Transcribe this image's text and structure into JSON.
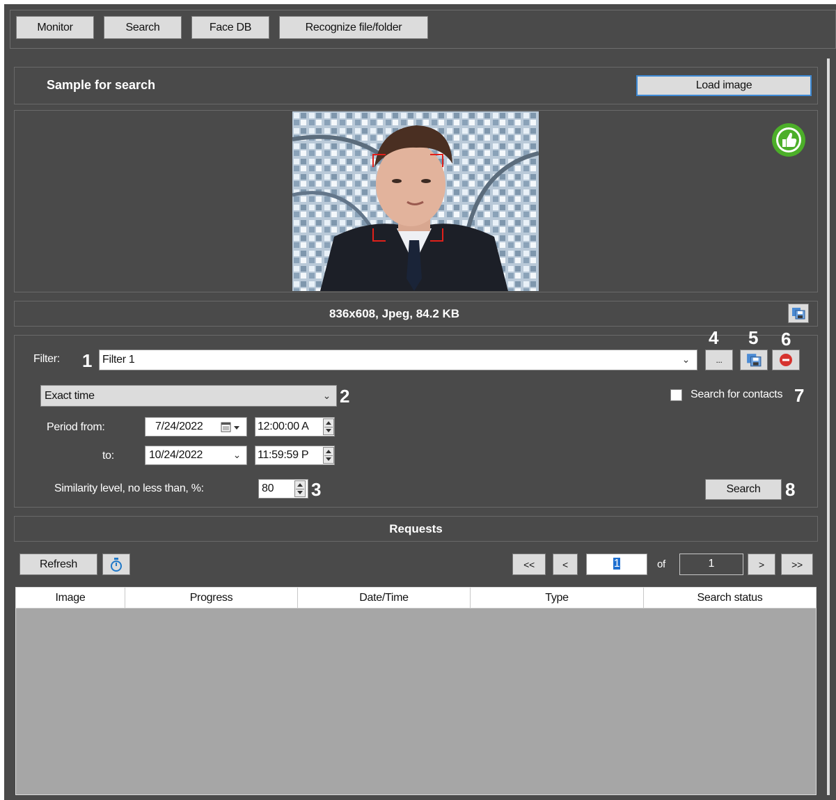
{
  "top_tabs": [
    "Monitor",
    "Search",
    "Face DB",
    "Recognize file/folder"
  ],
  "sample": {
    "title": "Sample for search",
    "load_image_label": "Load image",
    "image_info": "836x608, Jpeg, 84.2 KB"
  },
  "filter": {
    "label": "Filter:",
    "value": "Filter 1",
    "more_label": "...",
    "time_mode": "Exact time",
    "search_contacts_label": "Search for contacts",
    "period_from_label": "Period from:",
    "to_label": "to:",
    "date_from": "7/24/2022",
    "time_from": "12:00:00 A",
    "date_to": "10/24/2022",
    "time_to": "11:59:59 P",
    "similarity_label": "Similarity level, no less than, %:",
    "similarity_value": "80",
    "search_button": "Search"
  },
  "callouts": [
    "1",
    "2",
    "3",
    "4",
    "5",
    "6",
    "7",
    "8"
  ],
  "requests": {
    "title": "Requests",
    "refresh_label": "Refresh",
    "first_label": "<<",
    "prev_label": "<",
    "page_value": "1",
    "of_label": "of",
    "total_pages": "1",
    "next_label": ">",
    "last_label": ">>",
    "columns": [
      "Image",
      "Progress",
      "Date/Time",
      "Type",
      "Search status"
    ]
  },
  "icons": {
    "approved": "thumbs-up-icon",
    "save": "save-icon",
    "remove": "remove-icon",
    "timer": "timer-icon",
    "calendar": "calendar-icon",
    "dropdown": "chevron-down-icon"
  },
  "colors": {
    "background": "#4a4a4a",
    "accent_green": "#4caf29",
    "face_box": "#e0201a",
    "table_empty": "#a6a6a6"
  }
}
